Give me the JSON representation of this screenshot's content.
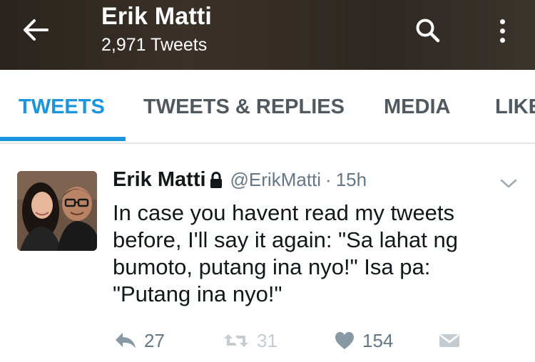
{
  "header": {
    "name": "Erik Matti",
    "tweet_count": "2,971 Tweets",
    "background": "#2f2822"
  },
  "tabs": [
    {
      "label": "TWEETS",
      "active": true
    },
    {
      "label": "TWEETS & REPLIES",
      "active": false
    },
    {
      "label": "MEDIA",
      "active": false
    },
    {
      "label": "LIKES",
      "active": false
    }
  ],
  "accent_color": "#1b95e0",
  "tweet": {
    "author_name": "Erik Matti",
    "protected_icon": "lock-icon",
    "handle": "@ErikMatti",
    "separator": "·",
    "time": "15h",
    "text": "In case you havent read my tweets before, I'll say it again: \"Sa lahat ng bumoto, putang ina nyo!\" Isa pa: \"Putang ina nyo!\"",
    "actions": {
      "reply_count": "27",
      "retweet_count": "31",
      "like_count": "154"
    }
  },
  "icons": {
    "back": "back-arrow-icon",
    "search": "search-icon",
    "overflow": "more-vertical-icon",
    "chevron": "chevron-down-icon",
    "reply": "reply-icon",
    "retweet": "retweet-icon",
    "like": "heart-icon",
    "dm": "envelope-icon"
  }
}
